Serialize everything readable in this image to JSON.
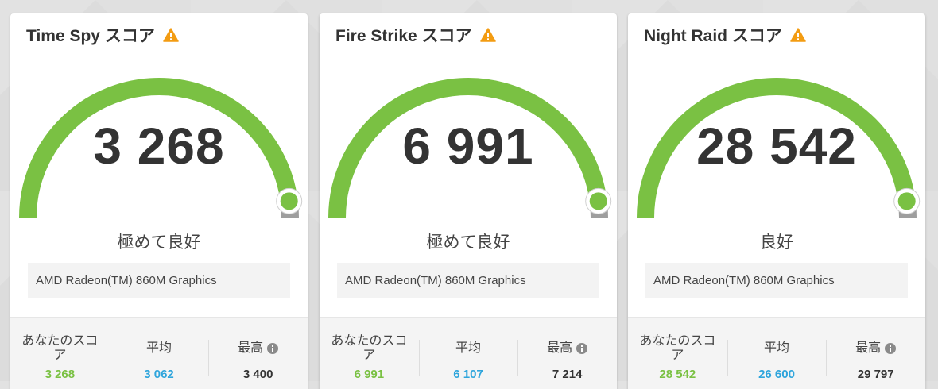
{
  "colors": {
    "gauge_green": "#7ac143",
    "average_blue": "#2fa5dc",
    "warning_orange": "#f39c12",
    "marker_gray": "#9e9e9e"
  },
  "icons": {
    "warning": "warning-icon",
    "info": "info-icon"
  },
  "cards": [
    {
      "title": "Time Spy スコア",
      "score": "3 268",
      "rating": "極めて良好",
      "gpu": "AMD Radeon(TM) 860M Graphics",
      "gauge_fraction": 0.96,
      "stats": {
        "your_score_label": "あなたのスコア",
        "your_score": "3 268",
        "average_label": "平均",
        "average": "3 062",
        "max_label": "最高",
        "max": "3 400"
      }
    },
    {
      "title": "Fire Strike スコア",
      "score": "6 991",
      "rating": "極めて良好",
      "gpu": "AMD Radeon(TM) 860M Graphics",
      "gauge_fraction": 0.96,
      "stats": {
        "your_score_label": "あなたのスコア",
        "your_score": "6 991",
        "average_label": "平均",
        "average": "6 107",
        "max_label": "最高",
        "max": "7 214"
      }
    },
    {
      "title": "Night Raid スコア",
      "score": "28 542",
      "rating": "良好",
      "gpu": "AMD Radeon(TM) 860M Graphics",
      "gauge_fraction": 0.96,
      "stats": {
        "your_score_label": "あなたのスコア",
        "your_score": "28 542",
        "average_label": "平均",
        "average": "26 600",
        "max_label": "最高",
        "max": "29 797"
      }
    }
  ]
}
